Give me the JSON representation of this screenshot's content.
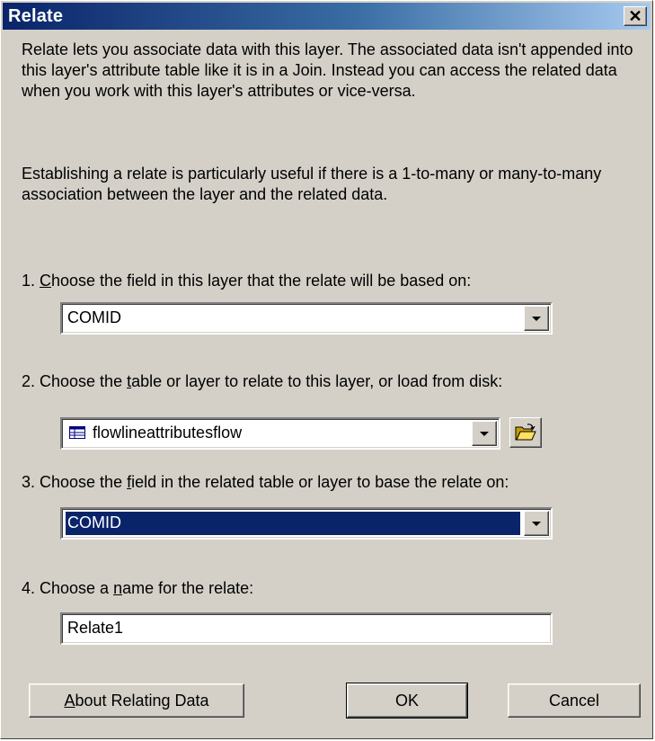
{
  "window": {
    "title": "Relate",
    "close_glyph": "✕"
  },
  "description": {
    "paragraph1": "Relate lets you associate data with this layer. The associated data isn't appended into this layer's attribute table like it is in a Join. Instead you can access the related data when you work with this layer's attributes or vice-versa.",
    "paragraph2": "Establishing a relate is particularly useful if there is a 1-to-many or many-to-many association between the layer and the related data."
  },
  "step1": {
    "label_prefix": "1. ",
    "label_mnemonic": "C",
    "label_rest": "hoose the field in this layer that the relate will be based on:",
    "value": "COMID"
  },
  "step2": {
    "label_prefix": "2. Choose the ",
    "label_mnemonic": "t",
    "label_rest": "able or layer to relate to this layer, or load from disk:",
    "value": "flowlineattributesflow",
    "icon": "table-icon",
    "browse_icon": "open-folder-icon"
  },
  "step3": {
    "label_prefix": "3. Choose the ",
    "label_mnemonic": "f",
    "label_rest": "ield in the related table or layer to base the relate on:",
    "value": "COMID"
  },
  "step4": {
    "label_prefix": "4. Choose a ",
    "label_mnemonic": "n",
    "label_rest": "ame for the relate:",
    "value": "Relate1"
  },
  "buttons": {
    "about_mnemonic": "A",
    "about_rest": "bout Relating Data",
    "ok": "OK",
    "cancel": "Cancel"
  },
  "colors": {
    "dialog_bg": "#d4d0c8",
    "title_start": "#0a246a",
    "selection": "#0a246a"
  }
}
